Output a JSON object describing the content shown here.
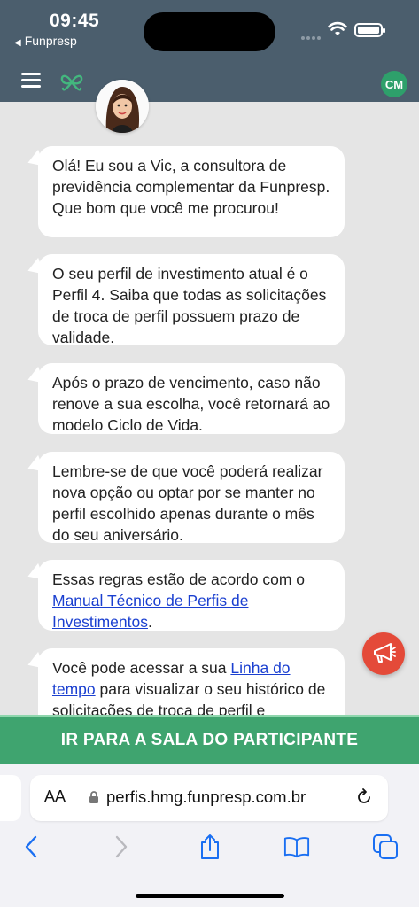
{
  "status_bar": {
    "time": "09:45",
    "back_app": "Funpresp"
  },
  "header": {
    "user_initials": "CM"
  },
  "chat": {
    "messages": [
      {
        "text": "Olá! Eu sou a Vic, a consultora de previdência complementar da Funpresp. Que bom que você me procurou!"
      },
      {
        "text": "O seu perfil de investimento atual é o Perfil 4. Saiba que todas as solicitações de troca de perfil possuem prazo de validade."
      },
      {
        "text": "Após o prazo de vencimento, caso não renove a sua escolha, você retornará ao modelo Ciclo de Vida."
      },
      {
        "text": "Lembre-se de que você poderá realizar nova opção ou optar por se manter no perfil escolhido apenas durante o mês do seu aniversário."
      },
      {
        "text_before": "Essas regras estão de acordo com o ",
        "link": "Manual Técnico de Perfis de Investimentos",
        "text_after": "."
      },
      {
        "text_before": "Você pode acessar a sua ",
        "link": "Linha do tempo",
        "text_after": " para visualizar o seu histórico de solicitações de troca de perfil e"
      }
    ]
  },
  "cta": {
    "label": "IR PARA A SALA DO PARTICIPANTE"
  },
  "browser": {
    "text_size_label": "AA",
    "url": "perfis.hmg.funpresp.com.br"
  },
  "colors": {
    "header_bg": "#4b5e6d",
    "cta_bg": "#3fa46f",
    "fab_bg": "#e44a39",
    "badge_bg": "#2ea06b",
    "link": "#1a3fd0",
    "chat_bg": "#e5e5e5"
  }
}
